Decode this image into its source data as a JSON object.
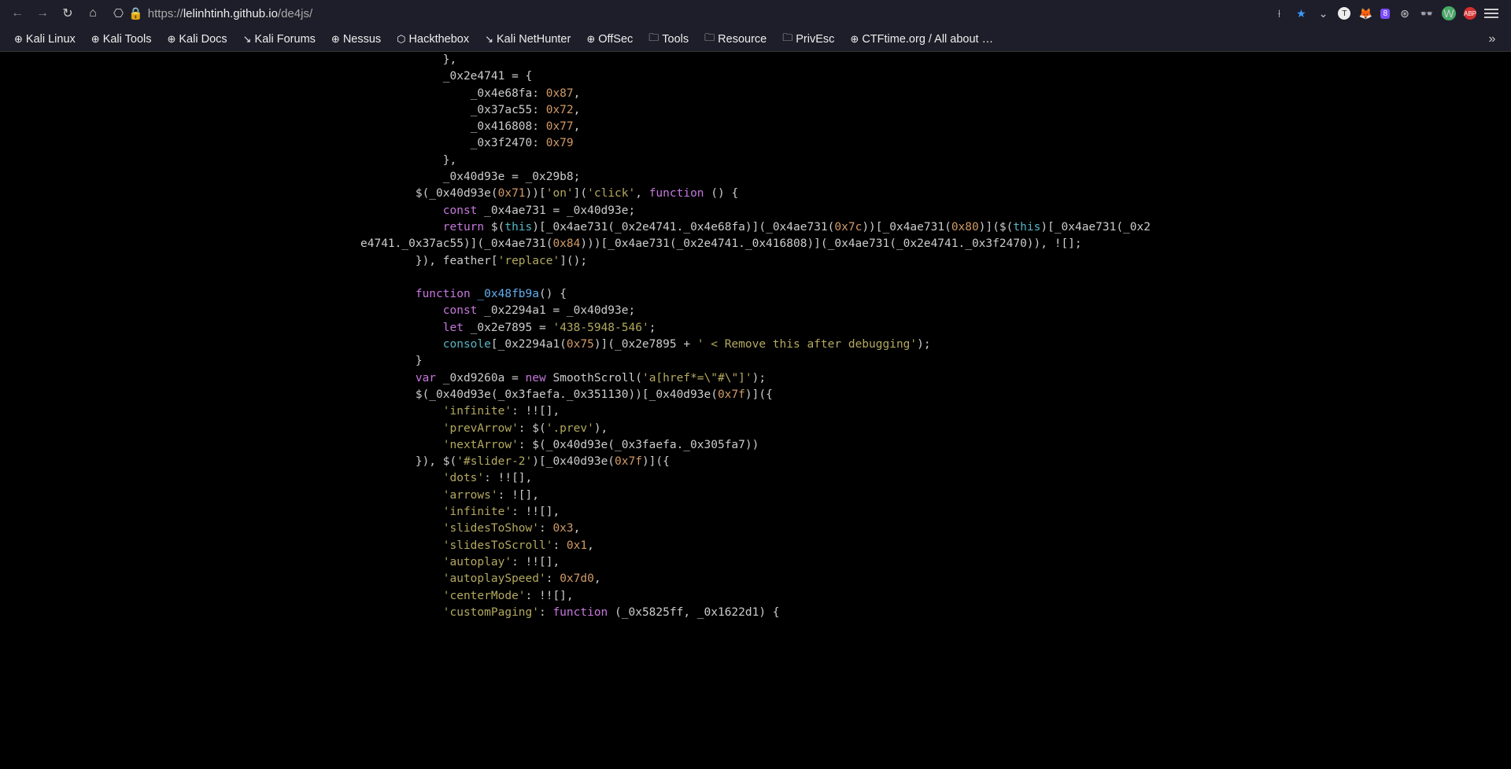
{
  "url": {
    "scheme_host": "https://",
    "domain": "lelinhtinh.github.io",
    "path": "/de4js/"
  },
  "bookmarks": [
    {
      "label": "Kali Linux",
      "icon": "⊕"
    },
    {
      "label": "Kali Tools",
      "icon": "⊕"
    },
    {
      "label": "Kali Docs",
      "icon": "⊕"
    },
    {
      "label": "Kali Forums",
      "icon": "↘"
    },
    {
      "label": "Nessus",
      "icon": "⊕"
    },
    {
      "label": "Hackthebox",
      "icon": "⬡"
    },
    {
      "label": "Kali NetHunter",
      "icon": "↘"
    },
    {
      "label": "OffSec",
      "icon": "⊕"
    },
    {
      "label": "Tools",
      "icon": "🗀"
    },
    {
      "label": "Resource",
      "icon": "🗀"
    },
    {
      "label": "PrivEsc",
      "icon": "🗀"
    },
    {
      "label": "CTFtime.org / All about …",
      "icon": "⊕"
    }
  ],
  "ext_badge": "8",
  "code": {
    "l1": "            },",
    "l2a": "            _0x2e4741 = {",
    "l3a": "                _0x4e68fa: ",
    "l3b": "0x87",
    "l3c": ",",
    "l4a": "                _0x37ac55: ",
    "l4b": "0x72",
    "l4c": ",",
    "l5a": "                _0x416808: ",
    "l5b": "0x77",
    "l5c": ",",
    "l6a": "                _0x3f2470: ",
    "l6b": "0x79",
    "l7": "            },",
    "l8": "            _0x40d93e = _0x29b8;",
    "l9a": "        $(_0x40d93e(",
    "l9b": "0x71",
    "l9c": "))[",
    "l9d": "'on'",
    "l9e": "](",
    "l9f": "'click'",
    "l9g": ", ",
    "l9h": "function",
    "l9i": " () {",
    "l10a": "            ",
    "l10b": "const",
    "l10c": " _0x4ae731 = _0x40d93e;",
    "l11a": "            ",
    "l11b": "return",
    "l11c": " $(",
    "l11d": "this",
    "l11e": ")[_0x4ae731(_0x2e4741._0x4e68fa)](_0x4ae731(",
    "l11f": "0x7c",
    "l11g": "))[_0x4ae731(",
    "l11h": "0x80",
    "l11i": ")]($(",
    "l11j": "this",
    "l11k": ")[_0x4ae731(_0x2e4741._0x37ac55)](_0x4ae731(",
    "l11l": "0x84",
    "l11m": ")))[_0x4ae731(_0x2e4741._0x416808)](_0x4ae731(_0x2e4741._0x3f2470)), ![];",
    "l12a": "        }), feather[",
    "l12b": "'replace'",
    "l12c": "]();",
    "l14a": "        ",
    "l14b": "function",
    "l14c": " ",
    "l14d": "_0x48fb9a",
    "l14e": "() {",
    "l15a": "            ",
    "l15b": "const",
    "l15c": " _0x2294a1 = _0x40d93e;",
    "l16a": "            ",
    "l16b": "let",
    "l16c": " _0x2e7895 = ",
    "l16d": "'438-5948-546'",
    "l16e": ";",
    "l17a": "            ",
    "l17b": "console",
    "l17c": "[_0x2294a1(",
    "l17d": "0x75",
    "l17e": ")](_0x2e7895 + ",
    "l17f": "' < Remove this after debugging'",
    "l17g": ");",
    "l18": "        }",
    "l19a": "        ",
    "l19b": "var",
    "l19c": " _0xd9260a = ",
    "l19d": "new",
    "l19e": " SmoothScroll(",
    "l19f": "'a[href*=\\\"#\\\"]'",
    "l19g": ");",
    "l20a": "        $(_0x40d93e(_0x3faefa._0x351130))[_0x40d93e(",
    "l20b": "0x7f",
    "l20c": ")]({",
    "l21a": "            ",
    "l21b": "'infinite'",
    "l21c": ": !![],",
    "l22a": "            ",
    "l22b": "'prevArrow'",
    "l22c": ": $(",
    "l22d": "'.prev'",
    "l22e": "),",
    "l23a": "            ",
    "l23b": "'nextArrow'",
    "l23c": ": $(_0x40d93e(_0x3faefa._0x305fa7))",
    "l24a": "        }), $(",
    "l24b": "'#slider-2'",
    "l24c": ")[_0x40d93e(",
    "l24d": "0x7f",
    "l24e": ")]({",
    "l25a": "            ",
    "l25b": "'dots'",
    "l25c": ": !![],",
    "l26a": "            ",
    "l26b": "'arrows'",
    "l26c": ": ![],",
    "l27a": "            ",
    "l27b": "'infinite'",
    "l27c": ": !![],",
    "l28a": "            ",
    "l28b": "'slidesToShow'",
    "l28c": ": ",
    "l28d": "0x3",
    "l28e": ",",
    "l29a": "            ",
    "l29b": "'slidesToScroll'",
    "l29c": ": ",
    "l29d": "0x1",
    "l29e": ",",
    "l30a": "            ",
    "l30b": "'autoplay'",
    "l30c": ": !![],",
    "l31a": "            ",
    "l31b": "'autoplaySpeed'",
    "l31c": ": ",
    "l31d": "0x7d0",
    "l31e": ",",
    "l32a": "            ",
    "l32b": "'centerMode'",
    "l32c": ": !![],",
    "l33a": "            ",
    "l33b": "'customPaging'",
    "l33c": ": ",
    "l33d": "function",
    "l33e": " (_0x5825ff, _0x1622d1) {"
  }
}
